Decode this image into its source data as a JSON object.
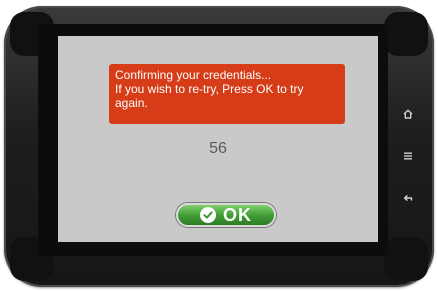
{
  "dialog": {
    "lines": [
      "Confirming your credentials...",
      "If you wish to re-try, Press OK to try",
      "again."
    ],
    "counter": "56",
    "ok_label": "OK"
  },
  "hardware_keys": [
    "home-icon",
    "menu-icon",
    "back-icon"
  ],
  "colors": {
    "message_background": "#d53c17",
    "screen_background": "#c9c9c9",
    "ok_button": "#3f9a34",
    "device_body": "#1e1e20"
  }
}
